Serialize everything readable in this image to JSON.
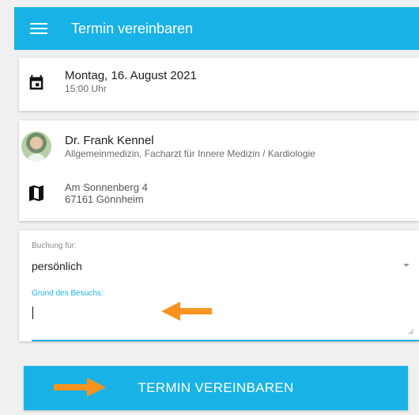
{
  "appbar": {
    "title": "Termin vereinbaren",
    "menu_icon": "hamburger-menu-icon"
  },
  "appointment": {
    "icon": "calendar-icon",
    "date": "Montag, 16. August 2021",
    "time": "15:00 Uhr"
  },
  "doctor": {
    "name": "Dr. Frank Kennel",
    "specialty": "Allgemeinmedizin, Facharzt für Innere Medizin / Kardiologie",
    "address_icon": "map-icon",
    "street": "Am Sonnenberg 4",
    "city": "67161 Gönnheim"
  },
  "form": {
    "booking_for_label": "Buchung für:",
    "booking_for_value": "persönlich",
    "reason_label": "Grund des Besuchs:",
    "reason_value": ""
  },
  "cta": {
    "label": "TERMIN VEREINBAREN"
  },
  "colors": {
    "primary": "#19b2e6",
    "annotation_arrow": "#f7931e",
    "background": "#f0f0f0"
  }
}
